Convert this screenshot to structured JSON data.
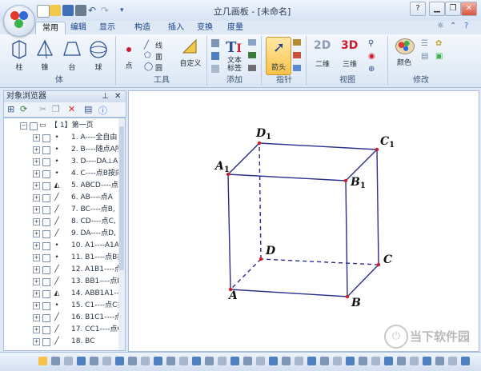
{
  "window": {
    "title": "立几画板 - [未命名]"
  },
  "tabs": [
    {
      "label": "常用",
      "active": true
    },
    {
      "label": "编辑",
      "active": false
    },
    {
      "label": "显示",
      "active": false
    },
    {
      "label": "构造",
      "active": false
    },
    {
      "label": "插入",
      "active": false
    },
    {
      "label": "变换",
      "active": false
    },
    {
      "label": "度量",
      "active": false
    }
  ],
  "ribbon": {
    "solid": {
      "items": [
        "柱",
        "锥",
        "台",
        "球"
      ],
      "group_label": "体"
    },
    "tools": {
      "point": "点",
      "line": "线",
      "face": "面",
      "circle": "圆",
      "custom": "自定义",
      "group_label": "工具"
    },
    "add": {
      "text_label": "文本\n标签",
      "group_label": "添加"
    },
    "pointer": {
      "arrow": "箭头",
      "group_label": "指针"
    },
    "view": {
      "two_d": "二维",
      "three_d": "三维",
      "group_label": "视图"
    },
    "modify": {
      "color": "颜色",
      "group_label": "修改"
    }
  },
  "panel": {
    "title": "对象浏览器",
    "root": "【 1】第一页",
    "items": [
      "1. A----全自由",
      "2. B----随点A所",
      "3. D----DA⊥A",
      "4. C----点B按向",
      "5. ABCD----点",
      "6. AB----点A",
      "7. BC----点B,",
      "8. CD----点C,",
      "9. DA----点D,",
      "10. A1----A1A",
      "11. B1----点B按",
      "12. A1B1----点",
      "13. BB1----点B",
      "14. ABB1A1---",
      "15. C1----点C按",
      "16. B1C1----点",
      "17. CC1----点C",
      "18. BC"
    ]
  },
  "canvas": {
    "labels": {
      "A": "A",
      "B": "B",
      "C": "C",
      "D": "D",
      "A1": "A1",
      "B1": "B1",
      "C1": "C1",
      "D1": "D1"
    }
  },
  "watermark": {
    "text": "当下软件园"
  },
  "colors": {
    "edge": "#2b2e8f",
    "point": "#d01b2a",
    "label": "#111111"
  }
}
